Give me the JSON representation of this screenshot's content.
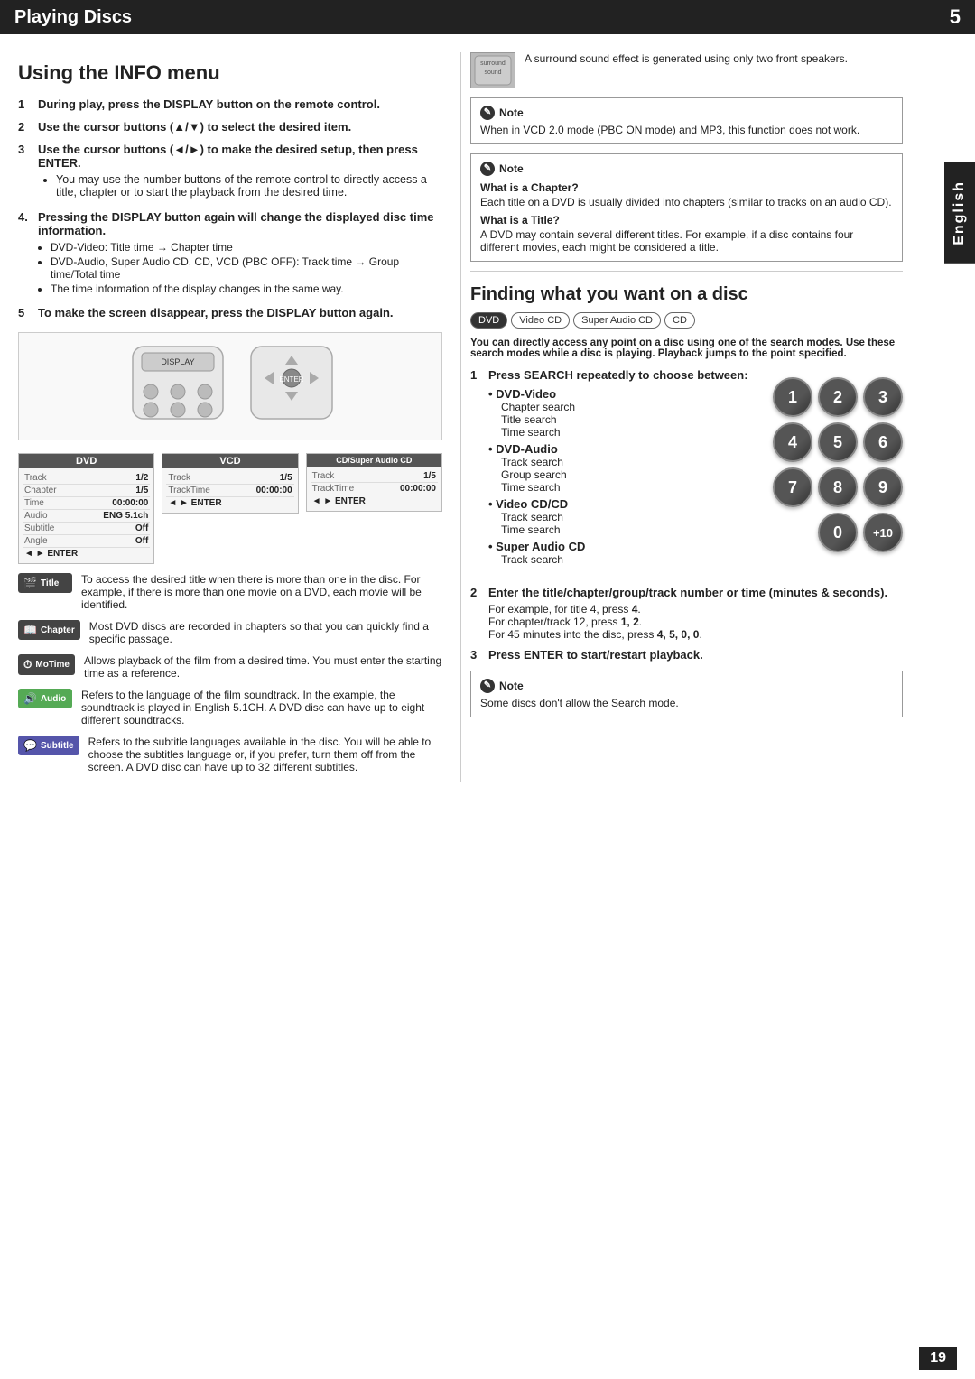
{
  "header": {
    "title": "Playing Discs",
    "page_number": "5"
  },
  "side_tab": "English",
  "page_footer": "19",
  "left_section": {
    "title": "Using the INFO menu",
    "steps": [
      {
        "num": "1",
        "text": "During play, press the DISPLAY button on the remote control."
      },
      {
        "num": "2",
        "text": "Use the cursor buttons (▲/▼) to select the desired item."
      },
      {
        "num": "3",
        "text": "Use the cursor buttons (◄/►) to make the desired setup, then press ENTER.",
        "bullet": "You may use the number buttons of the remote control to directly access a title, chapter or to start the playback from the desired time."
      },
      {
        "num": "4",
        "text": "Pressing the DISPLAY button again will change the displayed disc time information.",
        "bullets": [
          "DVD-Video: Title time → Chapter time",
          "DVD-Audio, Super Audio CD, CD, VCD (PBC OFF): Track time → Group time/Total time",
          "The time information of the display changes in the same way."
        ]
      },
      {
        "num": "5",
        "text": "To make the screen disappear, press the DISPLAY button again."
      }
    ],
    "screens": {
      "dvd_label": "DVD",
      "vcd_label": "VCD",
      "cd_label": "CD/Super Audio CD",
      "dvd_rows": [
        {
          "label": "Track",
          "value": "1/2"
        },
        {
          "label": "Chapter",
          "value": "1/5"
        },
        {
          "label": "Time",
          "value": "00:00:00"
        },
        {
          "label": "Audio",
          "value": "ENG 5.1ch"
        },
        {
          "label": "Subtitle",
          "value": "Off"
        },
        {
          "label": "Angle",
          "value": "Off"
        }
      ],
      "vcd_rows": [
        {
          "label": "Track",
          "value": "1/5"
        },
        {
          "label": "TrackTime",
          "value": "00:00:00"
        },
        {
          "label": "",
          "value": "◄ ►"
        },
        {
          "label": "",
          "value": "ENTER"
        }
      ],
      "cd_rows": [
        {
          "label": "Track",
          "value": "1/5"
        },
        {
          "label": "TrackTime",
          "value": "00:00:00"
        },
        {
          "label": "",
          "value": "◄ ►"
        },
        {
          "label": "",
          "value": "ENTER"
        }
      ]
    },
    "icon_items": [
      {
        "badge": "Title",
        "icon": "🎬",
        "text": "To access the desired title when there is more than one in the disc. For example, if there is more than one movie on a DVD, each movie will be identified."
      },
      {
        "badge": "Chapter",
        "icon": "📖",
        "text": "Most DVD discs are recorded in chapters so that you can quickly find a specific passage."
      },
      {
        "badge": "MoTime",
        "icon": "⏱",
        "text": "Allows playback of the film from a desired time. You must enter the starting time as a reference."
      },
      {
        "badge": "Audio",
        "icon": "🔊",
        "text": "Refers to the language of the film soundtrack. In the example, the soundtrack is played in English 5.1CH. A DVD disc can have up to eight different soundtracks."
      },
      {
        "badge": "Subtitle",
        "icon": "💬",
        "text": "Refers to the subtitle languages available in the disc. You will be able to choose the subtitles language or, if you prefer, turn them off from the screen. A DVD disc can have up to 32 different subtitles."
      }
    ]
  },
  "right_section": {
    "surround_text": "A surround sound effect is generated using only two front speakers.",
    "note1": {
      "title": "Note",
      "text": "When in VCD 2.0 mode (PBC ON mode) and MP3, this function does not work."
    },
    "note2": {
      "title": "Note",
      "what_is_chapter_title": "What is a Chapter?",
      "what_is_chapter_text": "Each title on a DVD is usually divided into chapters (similar to tracks on an audio CD).",
      "what_is_title_title": "What is a Title?",
      "what_is_title_text": "A DVD may contain several different titles. For example, if a disc contains four different movies, each might be considered a title."
    },
    "finding_section": {
      "title": "Finding what you want on a disc",
      "disc_tags": [
        "DVD",
        "Video CD",
        "Super Audio CD",
        "CD"
      ],
      "intro": "You can directly access any point on a disc using one of the search modes. Use these search modes while a disc is playing. Playback jumps to the point specified.",
      "steps": [
        {
          "num": "1",
          "text": "Press SEARCH repeatedly to choose between:",
          "options": [
            {
              "label": "DVD-Video",
              "items": [
                "Chapter search",
                "Title search",
                "Time search"
              ]
            },
            {
              "label": "DVD-Audio",
              "items": [
                "Track search",
                "Group search",
                "Time search"
              ]
            },
            {
              "label": "Video CD/CD",
              "items": [
                "Track search",
                "Time search"
              ]
            },
            {
              "label": "Super Audio CD",
              "items": [
                "Track search"
              ]
            }
          ]
        },
        {
          "num": "2",
          "text": "Enter the title/chapter/group/track number or time (minutes & seconds).",
          "sub": [
            "For example, for title 4, press 4.",
            "For chapter/track 12, press 1, 2.",
            "For 45 minutes into the disc, press 4, 5, 0, 0."
          ]
        },
        {
          "num": "3",
          "text": "Press ENTER to start/restart playback."
        }
      ],
      "note": {
        "title": "Note",
        "text": "Some discs don't allow the Search mode."
      },
      "numpad": [
        "1",
        "2",
        "3",
        "4",
        "5",
        "6",
        "7",
        "8",
        "9",
        "0",
        "+10"
      ]
    }
  }
}
